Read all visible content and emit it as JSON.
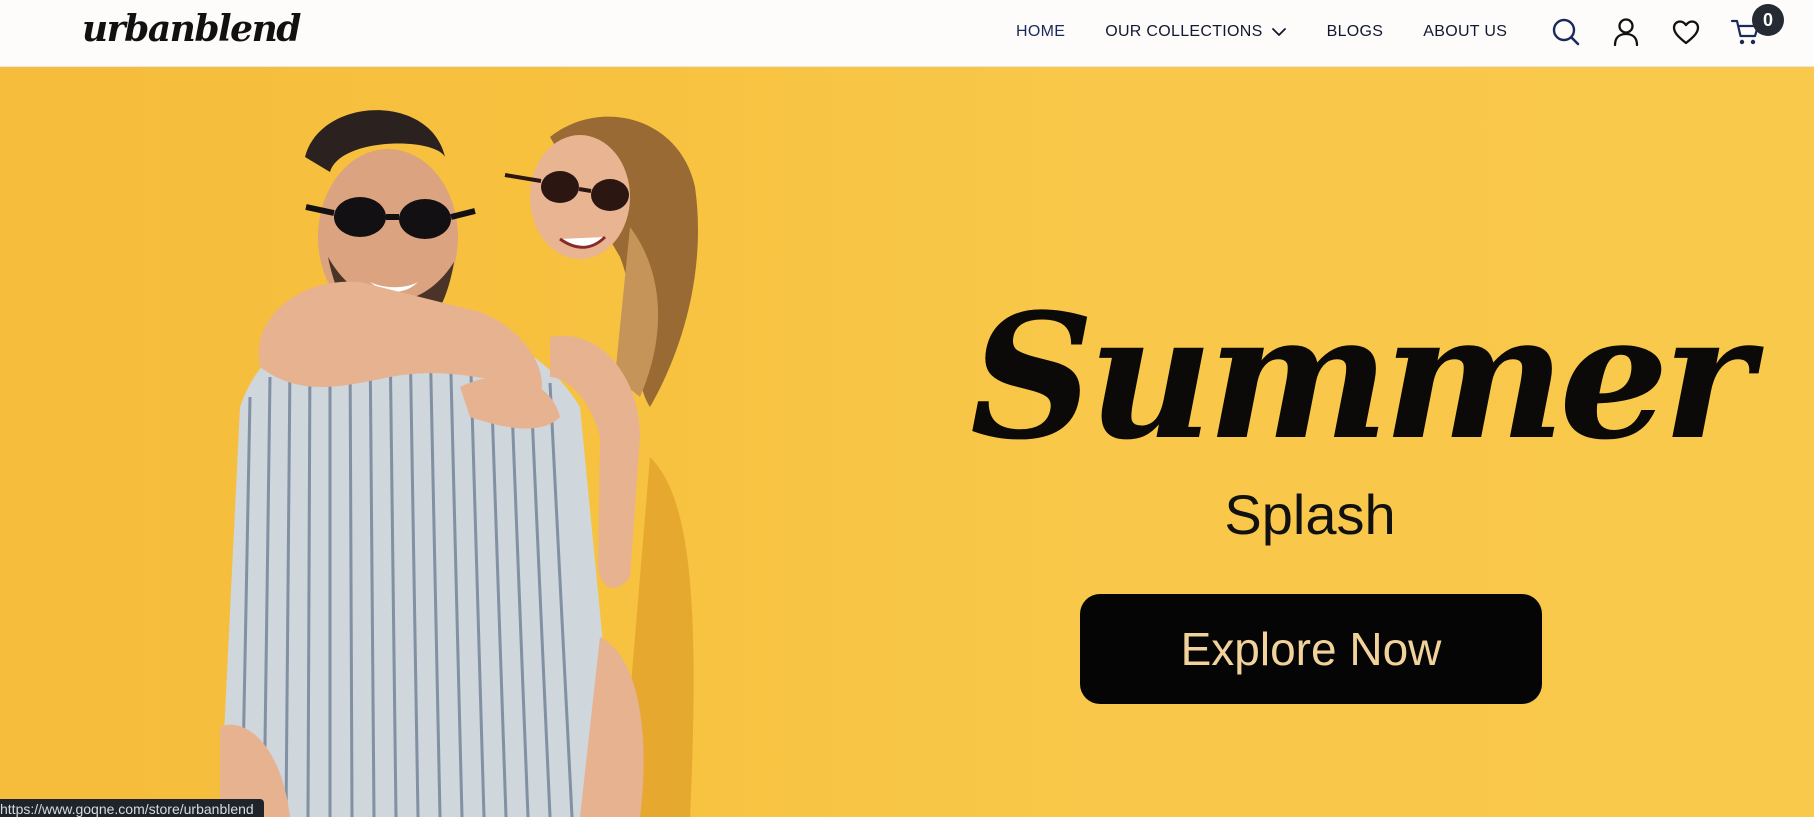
{
  "header": {
    "logo": "urbanblend",
    "nav": [
      {
        "label": "HOME"
      },
      {
        "label": "OUR COLLECTIONS"
      },
      {
        "label": "BLOGS"
      },
      {
        "label": "ABOUT US"
      }
    ],
    "icons": [
      "search-icon",
      "user-icon",
      "heart-icon",
      "cart-icon"
    ],
    "cart_count": "0"
  },
  "hero": {
    "headline": "Summer",
    "subheadline": "Splash",
    "cta_label": "Explore Now",
    "colors": {
      "background": "#f8c545",
      "cta_background": "#050505",
      "cta_text": "#f1d29a"
    }
  },
  "status_bar": {
    "url": "https://www.goqne.com/store/urbanblend"
  }
}
